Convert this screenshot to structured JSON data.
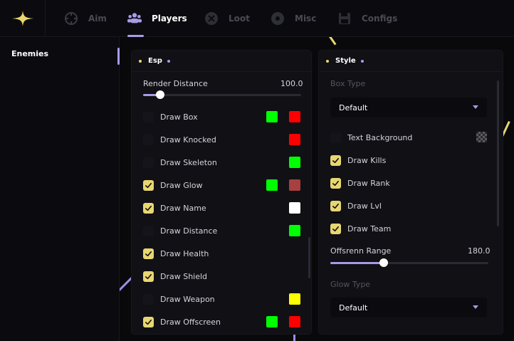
{
  "tabs": [
    {
      "label": "Aim",
      "icon": "crosshair-icon",
      "active": false
    },
    {
      "label": "Players",
      "icon": "users-icon",
      "active": true
    },
    {
      "label": "Loot",
      "icon": "loot-icon",
      "active": false
    },
    {
      "label": "Misc",
      "icon": "misc-icon",
      "active": false
    },
    {
      "label": "Configs",
      "icon": "save-icon",
      "active": false
    }
  ],
  "sidebar": {
    "items": [
      {
        "label": "Enemies",
        "active": true
      }
    ]
  },
  "esp": {
    "title": "Esp",
    "render_distance": {
      "label": "Render Distance",
      "value": "100.0",
      "fraction": 0.11
    },
    "items": [
      {
        "label": "Draw Box",
        "checked": false,
        "colors": [
          "#00ff00",
          "#ff0000"
        ]
      },
      {
        "label": "Draw Knocked",
        "checked": false,
        "colors": [
          "#ff0000"
        ]
      },
      {
        "label": "Draw Skeleton",
        "checked": false,
        "colors": [
          "#00ff00"
        ]
      },
      {
        "label": "Draw Glow",
        "checked": true,
        "colors": [
          "#00ff00",
          "#a84040"
        ]
      },
      {
        "label": "Draw Name",
        "checked": true,
        "colors": [
          "#ffffff"
        ]
      },
      {
        "label": "Draw Distance",
        "checked": false,
        "colors": [
          "#00ff00"
        ]
      },
      {
        "label": "Draw Health",
        "checked": true,
        "colors": []
      },
      {
        "label": "Draw Shield",
        "checked": true,
        "colors": []
      },
      {
        "label": "Draw Weapon",
        "checked": false,
        "colors": [
          "#ffff00"
        ]
      },
      {
        "label": "Draw Offscreen",
        "checked": true,
        "colors": [
          "#00ff00",
          "#ff0000"
        ]
      }
    ]
  },
  "style": {
    "title": "Style",
    "box_type": {
      "label": "Box Type",
      "value": "Default"
    },
    "items": [
      {
        "label": "Text Background",
        "checked": false
      },
      {
        "label": "Draw Kills",
        "checked": true
      },
      {
        "label": "Draw Rank",
        "checked": true
      },
      {
        "label": "Draw Lvl",
        "checked": true
      },
      {
        "label": "Draw Team",
        "checked": true
      }
    ],
    "offscreen_range": {
      "label": "Offsrenn Range",
      "value": "180.0",
      "fraction": 0.34
    },
    "glow_type": {
      "label": "Glow Type",
      "value": "Default"
    }
  },
  "colors": {
    "accent": "#a79be8",
    "check": "#e8d770",
    "background": "#09090c",
    "panel": "#101015"
  }
}
